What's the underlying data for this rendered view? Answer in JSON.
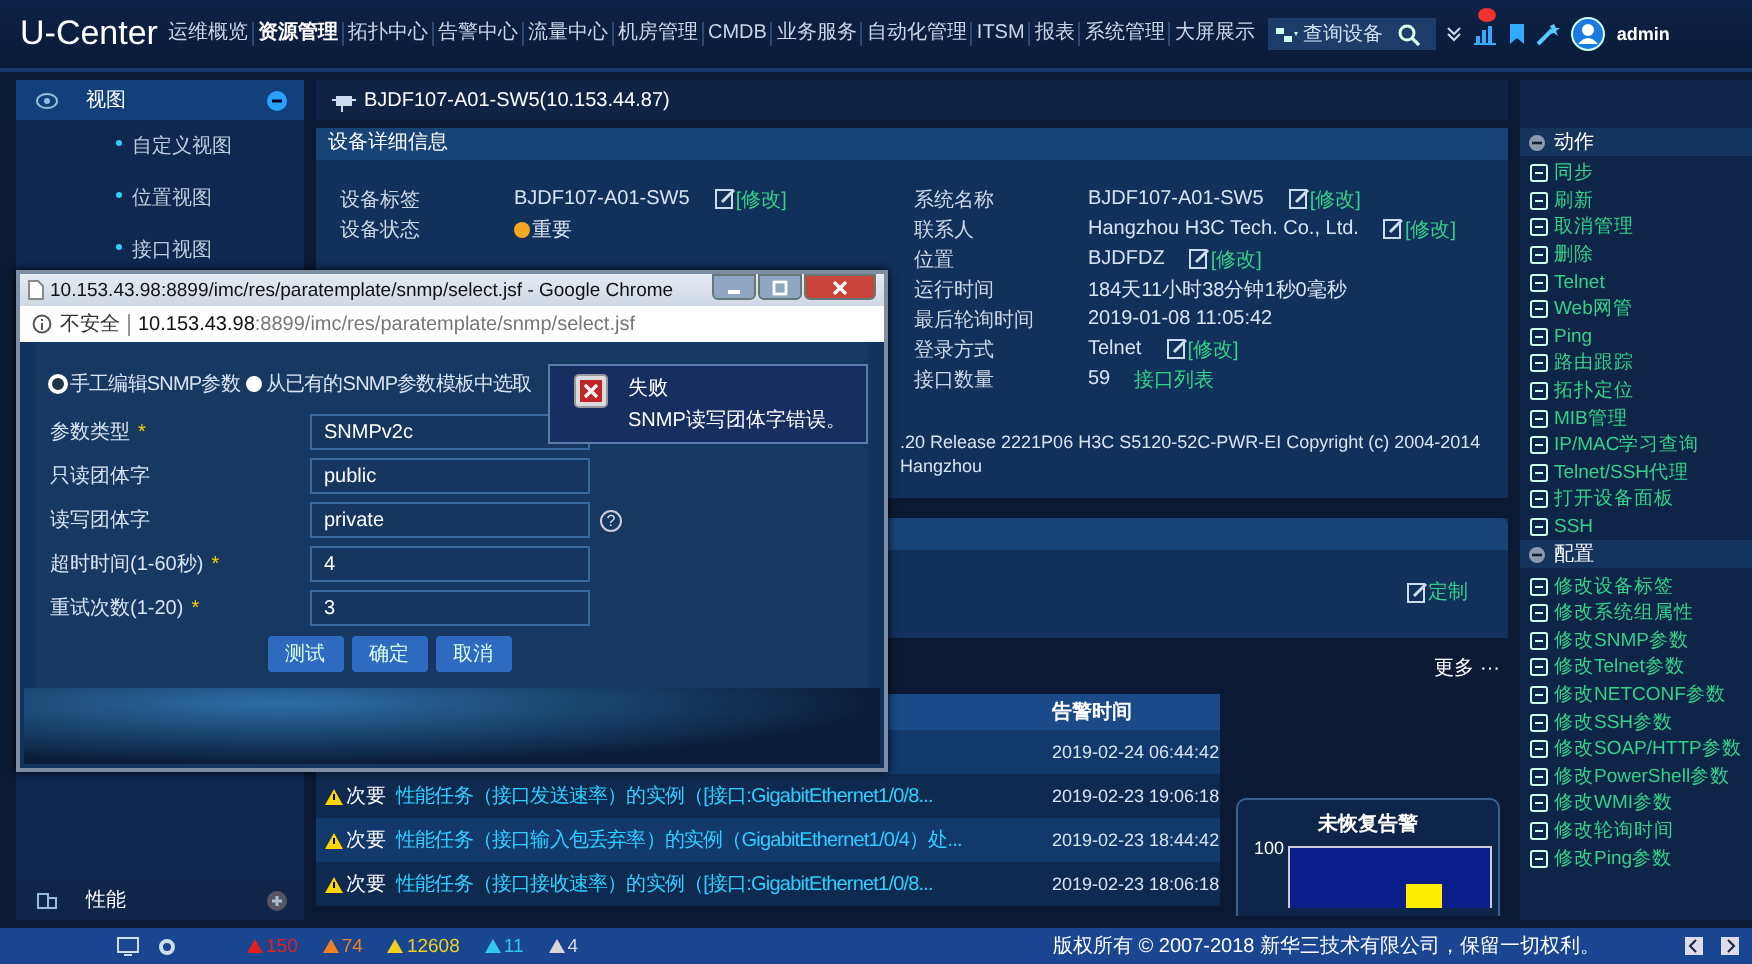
{
  "top_bar": {
    "logo": "U-Center",
    "nav": [
      {
        "label": "运维概览",
        "selected": false
      },
      {
        "label": "资源管理",
        "selected": true
      },
      {
        "label": "拓扑中心",
        "selected": false
      },
      {
        "label": "告警中心",
        "selected": false
      },
      {
        "label": "流量中心",
        "selected": false
      },
      {
        "label": "机房管理",
        "selected": false
      },
      {
        "label": "CMDB",
        "selected": false
      },
      {
        "label": "业务服务",
        "selected": false
      },
      {
        "label": "自动化管理",
        "selected": false
      },
      {
        "label": "ITSM",
        "selected": false
      },
      {
        "label": "报表",
        "selected": false
      },
      {
        "label": "系统管理",
        "selected": false
      },
      {
        "label": "大屏展示",
        "selected": false
      }
    ],
    "search": {
      "placeholder": "查询设备"
    },
    "user": "admin"
  },
  "sidebar": {
    "sections": [
      {
        "title": "视图",
        "expanded": true,
        "items": [
          "自定义视图",
          "位置视图",
          "接口视图"
        ]
      },
      {
        "title": "性能",
        "expanded": false
      }
    ]
  },
  "device": {
    "title": "BJDF107-A01-SW5(10.153.44.87)",
    "panel_title": "设备详细信息",
    "left_fields": [
      {
        "label": "设备标签",
        "value": "BJDF107-A01-SW5",
        "link": {
          "text": "[修改]",
          "kind": "edit"
        }
      },
      {
        "label": "设备状态",
        "value": "重要",
        "color": "#f5a623"
      }
    ],
    "right_fields": [
      {
        "label": "系统名称",
        "value": "BJDF107-A01-SW5",
        "link": {
          "text": "[修改]",
          "kind": "edit"
        }
      },
      {
        "label": "联系人",
        "value": "Hangzhou H3C Tech. Co., Ltd.",
        "link": {
          "text": "[修改]",
          "kind": "edit"
        }
      },
      {
        "label": "位置",
        "value": "BJDFDZ",
        "link": {
          "text": "[修改]",
          "kind": "edit"
        }
      },
      {
        "label": "运行时间",
        "value": "184天11小时38分钟1秒0毫秒"
      },
      {
        "label": "最后轮询时间",
        "value": "2019-01-08 11:05:42"
      },
      {
        "label": "登录方式",
        "value": "Telnet",
        "link": {
          "text": "[修改]",
          "kind": "edit"
        }
      },
      {
        "label": "接口数量",
        "value": "59",
        "link": {
          "text": "接口列表",
          "kind": "plain"
        }
      }
    ],
    "description": ".20 Release 2221P06 H3C S5120-52C-PWR-EI Copyright (c) 2004-2014 Hangzhou"
  },
  "customize": "定制",
  "alarms": {
    "more": "更多 ···",
    "time_column": "告警时间",
    "rows": [
      {
        "time": "2019-02-24 06:44:42"
      },
      {
        "level": "次要",
        "text": "性能任务（接口发送速率）的实例（[接口:GigabitEthernet1/0/8...",
        "time": "2019-02-23 19:06:18"
      },
      {
        "level": "次要",
        "text": "性能任务（接口输入包丢弃率）的实例（GigabitEthernet1/0/4）处...",
        "time": "2019-02-23 18:44:42"
      },
      {
        "level": "次要",
        "text": "性能任务（接口接收速率）的实例（[接口:GigabitEthernet1/0/8...",
        "time": "2019-02-23 18:06:18"
      }
    ]
  },
  "chart": {
    "title": "未恢复告警",
    "tick": "100"
  },
  "actions": {
    "sections": [
      {
        "title": "动作",
        "items": [
          "同步",
          "刷新",
          "取消管理",
          "删除",
          "Telnet",
          "Web网管",
          "Ping",
          "路由跟踪",
          "拓扑定位",
          "MIB管理",
          "IP/MAC学习查询",
          "Telnet/SSH代理",
          "打开设备面板",
          "SSH"
        ]
      },
      {
        "title": "配置",
        "items": [
          "修改设备标签",
          "修改系统组属性",
          "修改SNMP参数",
          "修改Telnet参数",
          "修改NETCONF参数",
          "修改SSH参数",
          "修改SOAP/HTTP参数",
          "修改PowerShell参数",
          "修改WMI参数",
          "修改轮询时间",
          "修改Ping参数"
        ]
      }
    ]
  },
  "footer": {
    "counts": [
      {
        "value": "150",
        "color": "#e02020"
      },
      {
        "value": "74",
        "color": "#f08020"
      },
      {
        "value": "12608",
        "color": "#f0d020"
      },
      {
        "value": "11",
        "color": "#30c8f0"
      },
      {
        "value": "4",
        "color": "#d8d8d8"
      }
    ],
    "copyright": "版权所有 © 2007-2018 新华三技术有限公司，保留一切权利。"
  },
  "dialog": {
    "title": "10.153.43.98:8899/imc/res/paratemplate/snmp/select.jsf - Google Chrome",
    "security": "不安全",
    "url_host": "10.153.43.98",
    "url_rest": ":8899/imc/res/paratemplate/snmp/select.jsf",
    "options": [
      {
        "label": "手工编辑SNMP参数",
        "selected": true
      },
      {
        "label": "从已有的SNMP参数模板中选取",
        "selected": false
      }
    ],
    "fields": [
      {
        "label": "参数类型",
        "required_mark": "*",
        "value": "SNMPv2c"
      },
      {
        "label": "只读团体字",
        "value": "public"
      },
      {
        "label": "读写团体字",
        "value": "private",
        "hint": "?"
      },
      {
        "label": "超时时间(1-60秒)",
        "required_mark": "*",
        "value": "4"
      },
      {
        "label": "重试次数(1-20)",
        "required_mark": "*",
        "value": "3"
      }
    ],
    "buttons": [
      "测试",
      "确定",
      "取消"
    ],
    "error": {
      "title": "失败",
      "message": "SNMP读写团体字错误。"
    }
  }
}
